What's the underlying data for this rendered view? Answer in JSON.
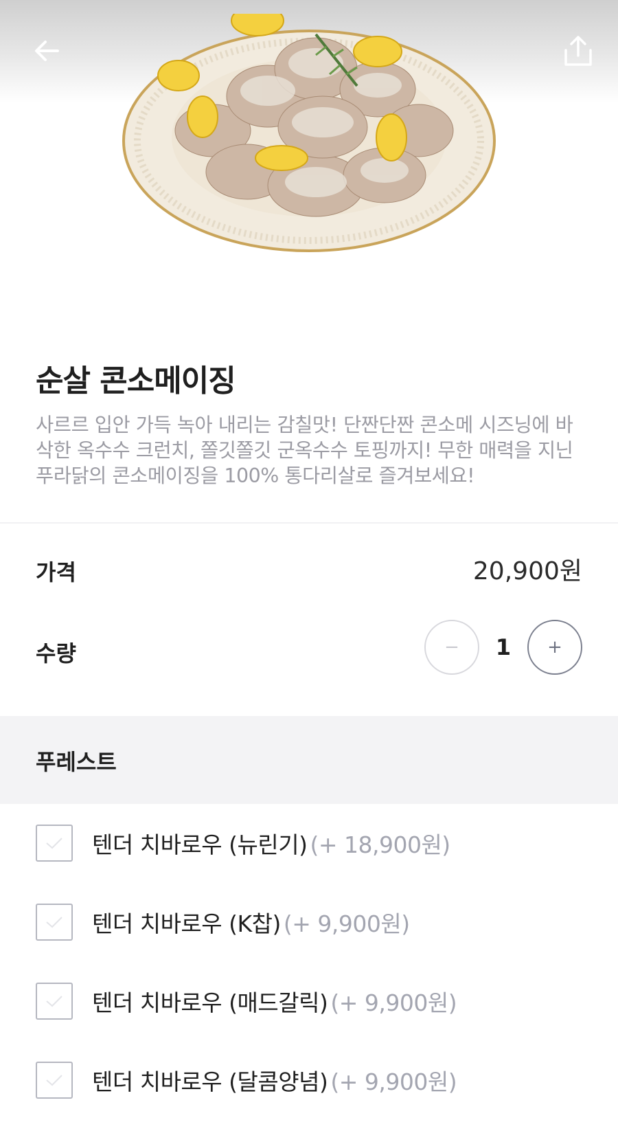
{
  "header": {
    "back_icon": "arrow-left-icon",
    "share_icon": "share-icon"
  },
  "product": {
    "name": "순살 콘소메이징",
    "description": "사르르 입안 가득 녹아 내리는 감칠맛! 단짠단짠 콘소메 시즈닝에 바삭한 옥수수 크런치, 쫄깃쫄깃 군옥수수 토핑까지! 무한 매력을 지닌 푸라닭의 콘소메이징을 100% 통다리살로 즐겨보세요!"
  },
  "price": {
    "label": "가격",
    "value": "20,900원"
  },
  "quantity": {
    "label": "수량",
    "value": "1",
    "minus": "−",
    "plus": "+"
  },
  "options_section": {
    "title": "푸레스트",
    "items": [
      {
        "name": "텐더 치바로우 (뉴린기)",
        "price": "(+ 18,900원)",
        "checked": false
      },
      {
        "name": "텐더 치바로우 (K찹)",
        "price": "(+ 9,900원)",
        "checked": false
      },
      {
        "name": "텐더 치바로우 (매드갈릭)",
        "price": "(+ 9,900원)",
        "checked": false
      },
      {
        "name": "텐더 치바로우 (달콤양념)",
        "price": "(+ 9,900원)",
        "checked": false
      }
    ]
  },
  "colors": {
    "text": "#1f1f1f",
    "muted": "#9b9ba3",
    "section_bg": "#f3f3f5",
    "checkbox_border": "#b5b7c0"
  }
}
